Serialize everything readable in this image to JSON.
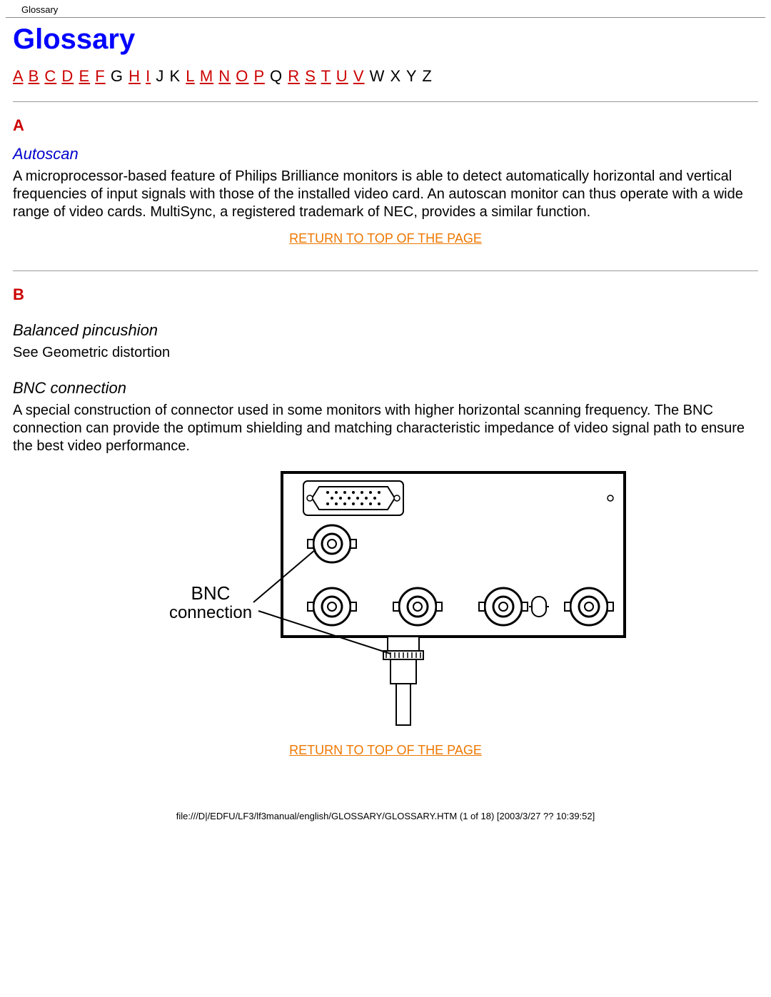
{
  "header": {
    "small_title": "Glossary"
  },
  "title": "Glossary",
  "alpha": {
    "A": "A",
    "B": "B",
    "C": "C",
    "D": "D",
    "E": "E",
    "F": "F",
    "G": "G",
    "H": "H",
    "I": "I",
    "J": "J",
    "K": "K",
    "L": "L",
    "M": "M",
    "N": "N",
    "O": "O",
    "P": "P",
    "Q": "Q",
    "R": "R",
    "S": "S",
    "T": "T",
    "U": "U",
    "V": "V",
    "W": "W",
    "X": "X",
    "Y": "Y",
    "Z": "Z"
  },
  "sections": {
    "A": {
      "letter": "A",
      "term1_title": "Autoscan",
      "term1_body": "A microprocessor-based feature of Philips Brilliance monitors is able to detect automatically horizontal and vertical frequencies of input signals with those of the installed video card. An autoscan monitor can thus operate with a wide range of video cards. MultiSync, a registered trademark of NEC, provides a similar function."
    },
    "B": {
      "letter": "B",
      "term1_title": "Balanced pincushion",
      "term1_body": "See Geometric distortion",
      "term2_title": "BNC connection",
      "term2_body": "A special construction of connector used in some monitors with higher horizontal scanning frequency. The BNC connection can provide the optimum shielding and matching characteristic impedance of video signal path to ensure the best video performance."
    }
  },
  "diagram": {
    "label_line1": "BNC",
    "label_line2": "connection"
  },
  "return_label": "RETURN TO TOP OF THE PAGE",
  "footer": "file:///D|/EDFU/LF3/lf3manual/english/GLOSSARY/GLOSSARY.HTM (1 of 18) [2003/3/27 ?? 10:39:52]"
}
